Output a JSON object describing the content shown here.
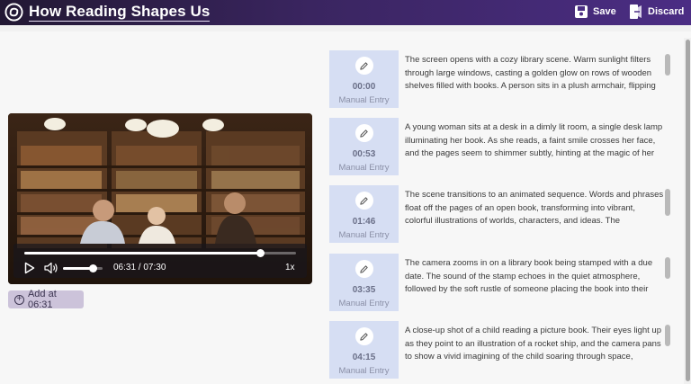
{
  "header": {
    "title": "How Reading Shapes Us",
    "save_label": "Save",
    "discard_label": "Discard"
  },
  "player": {
    "time_display": "06:31 / 07:30",
    "speed": "1x",
    "progress_fraction": 0.869,
    "volume_fraction": 0.75
  },
  "add_button": {
    "label": "Add at 06:31"
  },
  "entries": [
    {
      "time": "00:00",
      "label": "Manual Entry",
      "text": "The screen opens with a cozy library scene. Warm sunlight filters through large windows, casting a golden glow on rows of wooden shelves filled with books. A person sits in a plush armchair, flipping"
    },
    {
      "time": "00:53",
      "label": "Manual Entry",
      "text": "A young woman sits at a desk in a dimly lit room, a single desk lamp illuminating her book. As she reads, a faint smile crosses her face, and the pages seem to shimmer subtly, hinting at the magic of her imagination."
    },
    {
      "time": "01:46",
      "label": "Manual Entry",
      "text": "The scene transitions to an animated sequence. Words and phrases float off the pages of an open book, transforming into vibrant, colorful illustrations of worlds, characters, and ideas. The background music"
    },
    {
      "time": "03:35",
      "label": "Manual Entry",
      "text": "The camera zooms in on a library book being stamped with a due date. The sound of the stamp echoes in the quiet atmosphere, followed by the soft rustle of someone placing the book into their bag before"
    },
    {
      "time": "04:15",
      "label": "Manual Entry",
      "text": "A close-up shot of a child reading a picture book. Their eyes light up as they point to an illustration of a rocket ship, and the camera pans to show a vivid imagining of the child soaring through space, surrounded"
    }
  ]
}
